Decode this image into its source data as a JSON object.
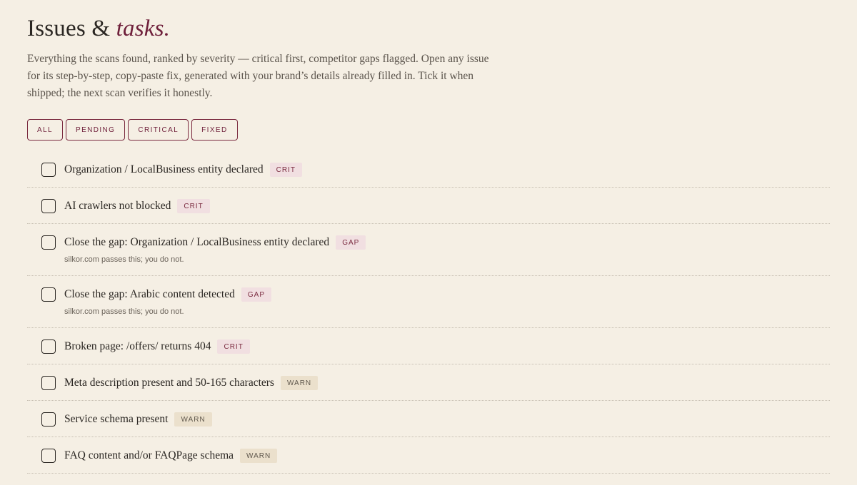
{
  "header": {
    "title_main": "Issues &",
    "title_accent": "tasks.",
    "intro": "Everything the scans found, ranked by severity — critical first, competitor gaps flagged. Open any issue for its step-by-step, copy-paste fix, generated with your brand’s details already filled in. Tick it when shipped; the next scan verifies it honestly."
  },
  "filters": [
    {
      "label": "ALL"
    },
    {
      "label": "PENDING"
    },
    {
      "label": "CRITICAL"
    },
    {
      "label": "FIXED"
    }
  ],
  "issues": [
    {
      "title": "Organization / LocalBusiness entity declared",
      "badge": "CRIT",
      "note": ""
    },
    {
      "title": "AI crawlers not blocked",
      "badge": "CRIT",
      "note": ""
    },
    {
      "title": "Close the gap: Organization / LocalBusiness entity declared",
      "badge": "GAP",
      "note": "silkor.com passes this; you do not."
    },
    {
      "title": "Close the gap: Arabic content detected",
      "badge": "GAP",
      "note": "silkor.com passes this; you do not."
    },
    {
      "title": "Broken page: /offers/ returns 404",
      "badge": "CRIT",
      "note": ""
    },
    {
      "title": "Meta description present and 50-165 characters",
      "badge": "WARN",
      "note": ""
    },
    {
      "title": "Service schema present",
      "badge": "WARN",
      "note": ""
    },
    {
      "title": "FAQ content and/or FAQPage schema",
      "badge": "WARN",
      "note": ""
    }
  ],
  "colors": {
    "background": "#f5efe4",
    "accent": "#6e1f3a",
    "crit_badge_bg": "#f1dfe1",
    "warn_badge_bg": "#ebe0cc"
  }
}
